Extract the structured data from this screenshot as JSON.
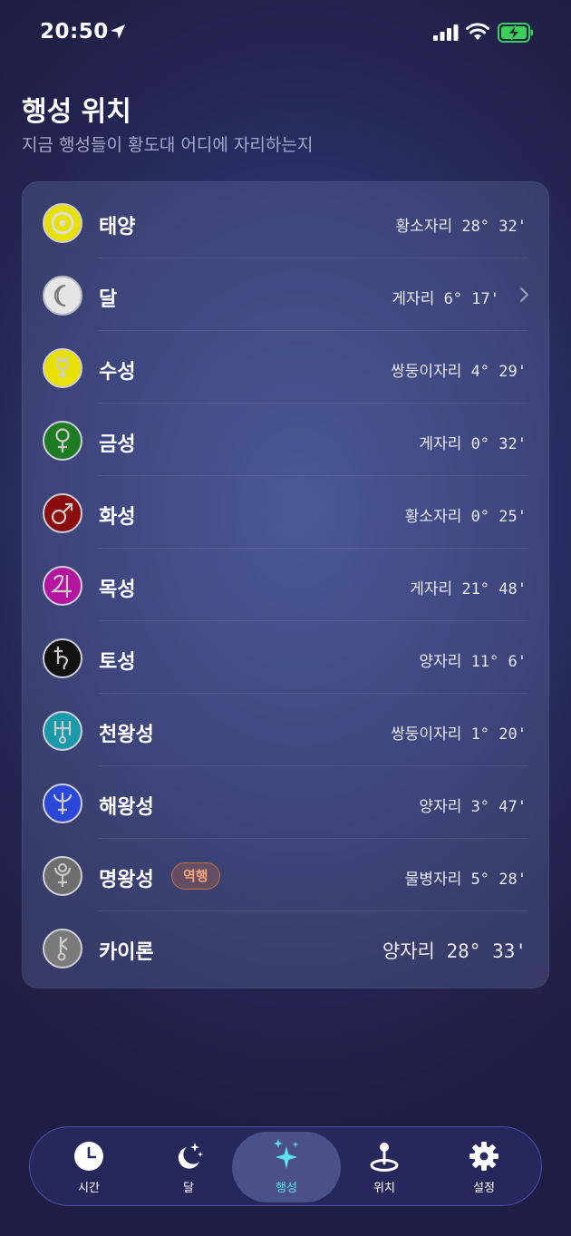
{
  "status_bar": {
    "time": "20:50"
  },
  "header": {
    "title": "행성 위치",
    "subtitle": "지금 행성들이 황도대 어디에 자리하는지"
  },
  "planets": [
    {
      "name": "태양",
      "position": "황소자리 28° 32'",
      "color": "#e8e000",
      "glyph": "sun-icon"
    },
    {
      "name": "달",
      "position": "게자리 6° 17'",
      "color": "#e6e6e6",
      "glyph": "moon-icon"
    },
    {
      "name": "수성",
      "position": "쌍둥이자리 4° 29'",
      "color": "#e8e000",
      "glyph": "mercury-icon"
    },
    {
      "name": "금성",
      "position": "게자리 0° 32'",
      "color": "#1f7a24",
      "glyph": "venus-icon"
    },
    {
      "name": "화성",
      "position": "황소자리 0° 25'",
      "color": "#8a0c0c",
      "glyph": "mars-icon"
    },
    {
      "name": "목성",
      "position": "게자리 21° 48'",
      "color": "#b4149e",
      "glyph": "jupiter-icon"
    },
    {
      "name": "토성",
      "position": "양자리 11° 6'",
      "color": "#111111",
      "glyph": "saturn-icon"
    },
    {
      "name": "천왕성",
      "position": "쌍둥이자리 1° 20'",
      "color": "#1a9aa8",
      "glyph": "uranus-icon"
    },
    {
      "name": "해왕성",
      "position": "양자리 3° 47'",
      "color": "#2a47d8",
      "glyph": "neptune-icon"
    },
    {
      "name": "명왕성",
      "position": "물병자리 5° 28'",
      "color": "#6d6d6d",
      "glyph": "pluto-icon",
      "badge": "역행"
    },
    {
      "name": "카이론",
      "position": "양자리 28° 33'",
      "color": "#7a7a7a",
      "glyph": "chiron-icon"
    }
  ],
  "tabbar": {
    "tabs": [
      {
        "label": "시간",
        "icon": "clock-icon"
      },
      {
        "label": "달",
        "icon": "moon-stars-icon"
      },
      {
        "label": "행성",
        "icon": "sparkles-icon",
        "active": true
      },
      {
        "label": "위치",
        "icon": "location-pin-icon"
      },
      {
        "label": "설정",
        "icon": "gear-icon"
      }
    ]
  }
}
